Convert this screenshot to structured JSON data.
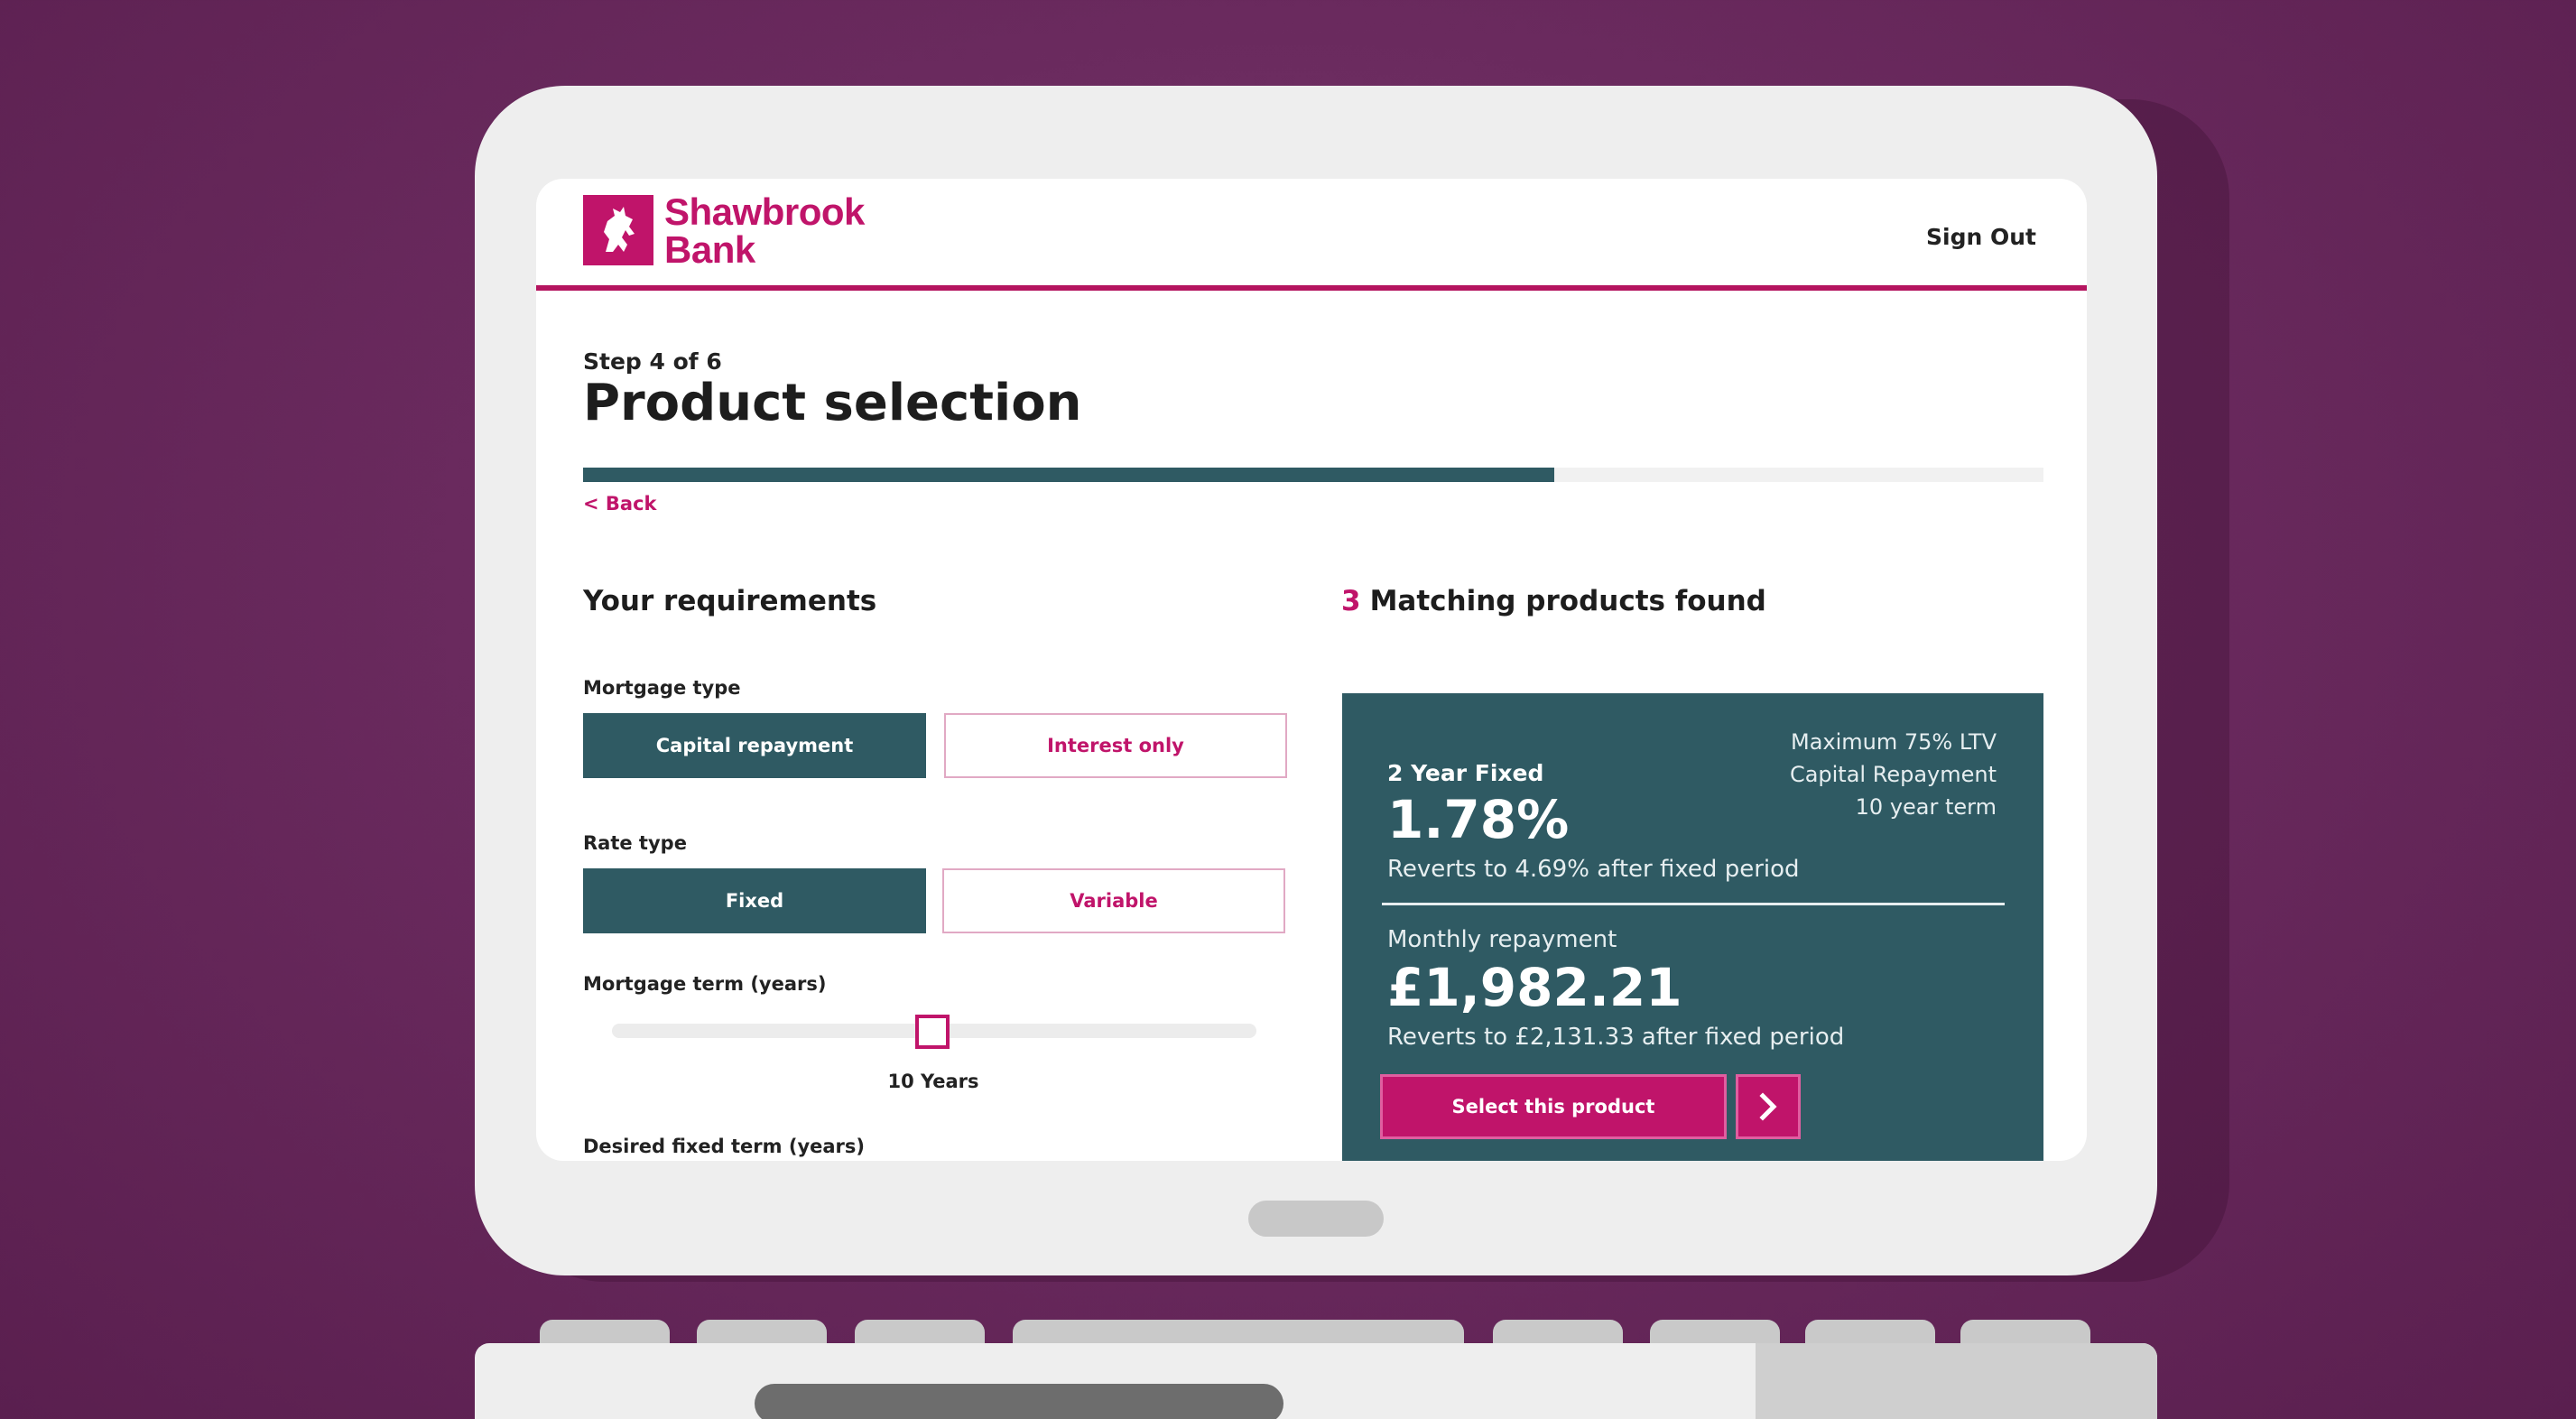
{
  "brand": {
    "name_line1": "Shawbrook",
    "name_line2": "Bank",
    "accent": "#c0146a",
    "primary": "#2f5a63"
  },
  "header": {
    "sign_out": "Sign Out"
  },
  "page": {
    "step": "Step 4 of 6",
    "title": "Product selection",
    "progress_fraction": 0.665,
    "back": "< Back"
  },
  "requirements": {
    "heading": "Your requirements",
    "mortgage_type": {
      "label": "Mortgage type",
      "options": [
        "Capital repayment",
        "Interest only"
      ],
      "selected": "Capital repayment"
    },
    "rate_type": {
      "label": "Rate type",
      "options": [
        "Fixed",
        "Variable"
      ],
      "selected": "Fixed"
    },
    "mortgage_term": {
      "label": "Mortgage term (years)",
      "value_text": "10 Years"
    },
    "fixed_term": {
      "label": "Desired fixed term (years)"
    }
  },
  "results": {
    "count": "3",
    "heading": "Matching products found",
    "product": {
      "name": "2 Year Fixed",
      "rate": "1.78%",
      "revert": "Reverts to 4.69% after fixed period",
      "meta": [
        "Maximum 75% LTV",
        "Capital Repayment",
        "10 year term"
      ],
      "monthly_label": "Monthly repayment",
      "monthly_value": "£1,982.21",
      "monthly_revert": "Reverts to £2,131.33 after fixed period",
      "select_label": "Select this product"
    }
  },
  "icons": {
    "logo": "rampant-lion-icon",
    "next": "chevron-right-icon"
  }
}
